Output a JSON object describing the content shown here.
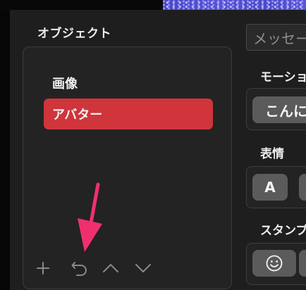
{
  "objects": {
    "title": "オブジェクト",
    "items": [
      {
        "label": "画像",
        "selected": false
      },
      {
        "label": "アバター",
        "selected": true
      }
    ],
    "toolbar": {
      "add_icon": "plus-icon",
      "undo_icon": "undo-icon",
      "up_icon": "chevron-up-icon",
      "down_icon": "chevron-down-icon"
    }
  },
  "message": {
    "placeholder": "メッセー"
  },
  "motion": {
    "title": "モーショ",
    "chip_label": "こんに"
  },
  "expression": {
    "title": "表情",
    "chip_label": "A"
  },
  "stamp": {
    "title": "スタンプ",
    "chip_icon": "smiley-icon"
  },
  "colors": {
    "accent": "#cf353b",
    "annotation_arrow": "#f0306e"
  }
}
